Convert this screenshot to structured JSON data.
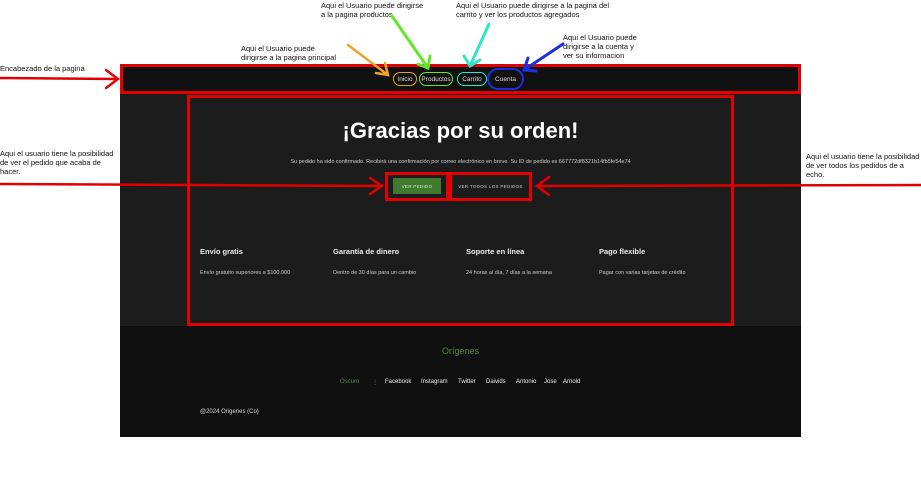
{
  "annotations": {
    "header": "Encabezado de la pagina",
    "home": [
      "Aqui el Usuario puede",
      "dirigirse a la pagina principal"
    ],
    "products": [
      "Aqui el Usuario puede dirigirse",
      "a la pagina productos"
    ],
    "cart": [
      "Aqui el Usuario puede dirigirse a la pagina del",
      "carrito y ver los productos agregados"
    ],
    "account": [
      "Aqui el Usuario puede",
      "dirigirse a la cuenta y",
      "ver su informacion"
    ],
    "order": [
      "Aqui el usuario tiene la posibilidad",
      "de ver el pedido que acaba de",
      "hacer."
    ],
    "orders": [
      "Aqui el usuario tiene la posibilidad",
      "de ver todos los pedidos de a",
      "echo."
    ]
  },
  "nav": {
    "inicio": "Inicio",
    "productos": "Productos",
    "carrito": "Carrito",
    "cuenta": "Cuenta"
  },
  "main": {
    "title": "¡Gracias por su orden!",
    "confirmation": "Su pedido ha sido confirmado. Recibirá una confirmación por correo electrónico en breve. Su ID de pedido es 667772df8321b14fb5fe54e74",
    "view_order": "VER PEDIDO",
    "view_all": "VER TODOS LOS PEDIDOS"
  },
  "features": [
    {
      "title": "Envío gratis",
      "desc": "Envío gratuito superiores a $100.000"
    },
    {
      "title": "Garantía de dinero",
      "desc": "Dentro de 30 días para un cambio"
    },
    {
      "title": "Soporte en línea",
      "desc": "24 horas al día, 7 días a la semana"
    },
    {
      "title": "Pago flexible",
      "desc": "Pagar con varias tarjetas de crédito"
    }
  ],
  "footer": {
    "brand": "Orígenes",
    "links": [
      "Oscuro",
      "Facebook",
      "Instagram",
      "Twitter",
      "Daivids",
      "Antonio",
      "Jose",
      "Arnold"
    ],
    "copyright": "@2024 Origenes (Co)"
  },
  "colors": {
    "annotation_red": "#e30000",
    "brand_green": "#4f8a3a",
    "button_green": "#3f7a2f"
  }
}
